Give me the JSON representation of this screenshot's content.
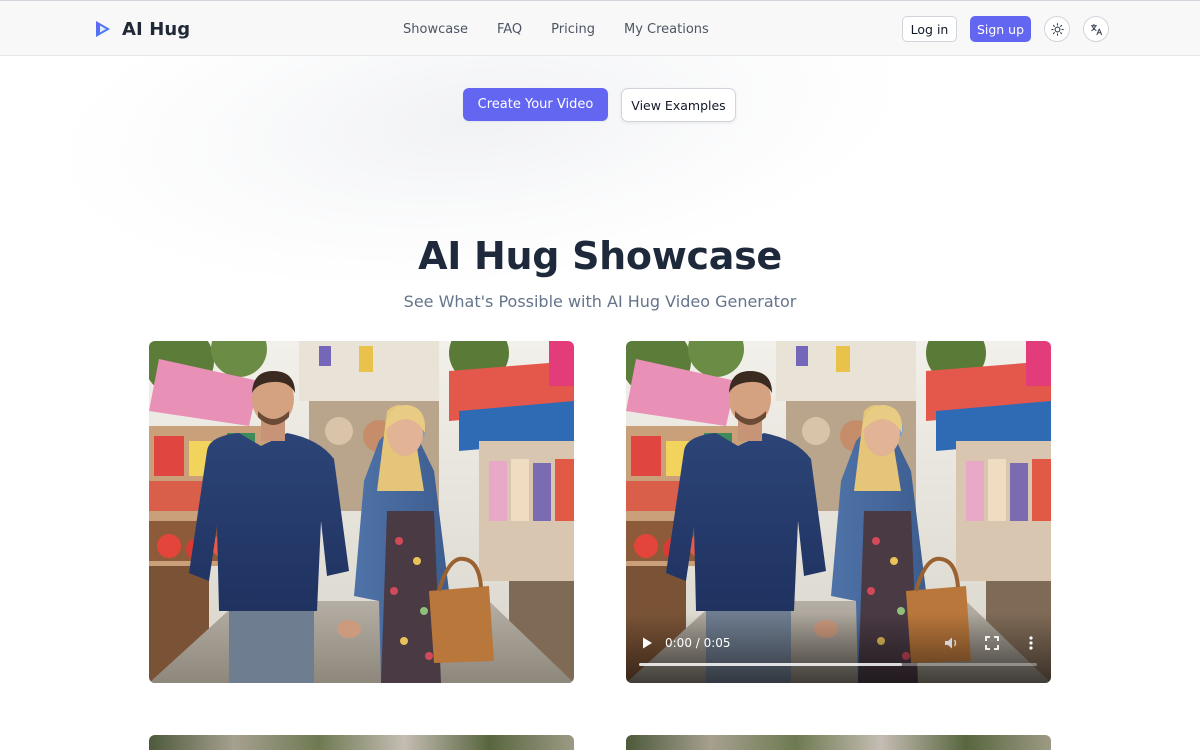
{
  "header": {
    "brand": "AI Hug",
    "nav": [
      "Showcase",
      "FAQ",
      "Pricing",
      "My Creations"
    ],
    "login_label": "Log in",
    "signup_label": "Sign up"
  },
  "hero": {
    "primary_cta": "Create Your Video",
    "secondary_cta": "View Examples"
  },
  "showcase": {
    "title": "AI Hug Showcase",
    "subtitle": "See What's Possible with AI Hug Video Generator",
    "video": {
      "time": "0:00 / 0:05",
      "progress": 0.66
    }
  },
  "colors": {
    "accent": "#6366f1",
    "heading": "#1e293b",
    "muted": "#64748b"
  }
}
